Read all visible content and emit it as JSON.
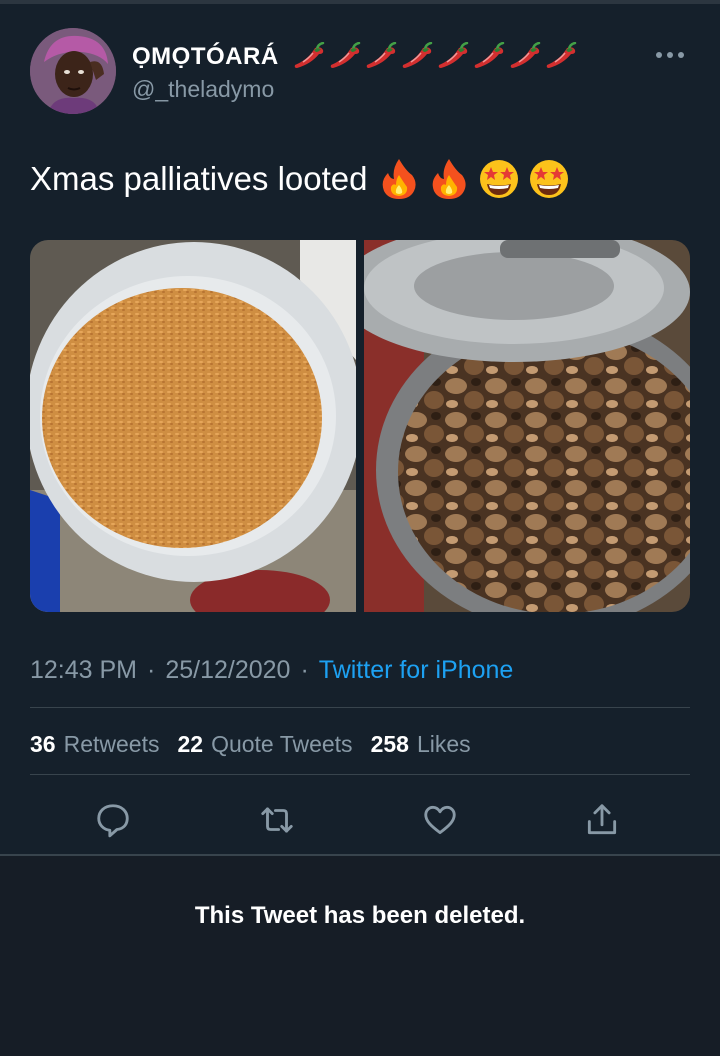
{
  "tweet": {
    "author": {
      "display_name": "ỌMỌTÓARÁ",
      "handle": "@_theladymo",
      "name_emoji_count": 8,
      "name_emoji_icon": "hot-pepper-icon"
    },
    "text": "Xmas palliatives looted",
    "text_emoji_icons": [
      "fire-icon",
      "fire-icon",
      "star-struck-icon",
      "star-struck-icon"
    ],
    "media": [
      {
        "name": "jollof-rice-photo"
      },
      {
        "name": "cooked-meat-pot-photo"
      }
    ],
    "meta": {
      "time": "12:43 PM",
      "date": "25/12/2020",
      "source": "Twitter for iPhone",
      "separator": "·"
    },
    "stats": [
      {
        "count": "36",
        "label": "Retweets"
      },
      {
        "count": "22",
        "label": "Quote Tweets"
      },
      {
        "count": "258",
        "label": "Likes"
      }
    ],
    "actions": [
      "reply-icon",
      "retweet-icon",
      "like-icon",
      "share-icon"
    ]
  },
  "deleted_notice": "This Tweet has been deleted.",
  "colors": {
    "background": "#15202b",
    "secondary_text": "#8899a6",
    "link": "#1da1f2",
    "divider": "#38444d"
  }
}
